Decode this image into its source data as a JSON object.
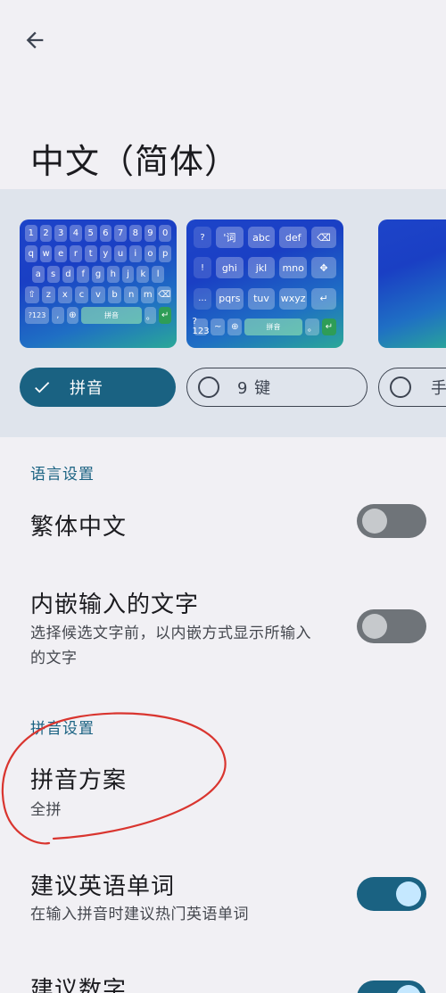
{
  "page": {
    "title": "中文（简体）"
  },
  "keyboard_previews": {
    "qwerty": {
      "row1": [
        "1",
        "2",
        "3",
        "4",
        "5",
        "6",
        "7",
        "8",
        "9",
        "0"
      ],
      "row2": [
        "q",
        "w",
        "e",
        "r",
        "t",
        "y",
        "u",
        "i",
        "o",
        "p"
      ],
      "row3": [
        "a",
        "s",
        "d",
        "f",
        "g",
        "h",
        "j",
        "k",
        "l"
      ],
      "row4": [
        "z",
        "x",
        "c",
        "v",
        "b",
        "n",
        "m"
      ],
      "row5": [
        "?123",
        ",",
        "拼音",
        "。"
      ]
    },
    "nine_key": {
      "keys": [
        "'词",
        "abc",
        "def",
        "ghi",
        "jkl",
        "mno",
        "pqrs",
        "tuv",
        "wxyz"
      ],
      "side": [
        "?",
        "!",
        "...",
        "~"
      ],
      "bottom": [
        "?123",
        ",",
        "拼音",
        "。"
      ]
    }
  },
  "layouts": [
    {
      "label": "拼音",
      "selected": true
    },
    {
      "label": "9 键",
      "selected": false
    },
    {
      "label": "手",
      "selected": false
    }
  ],
  "sections": {
    "language": {
      "header": "语言设置",
      "traditional": {
        "title": "繁体中文",
        "enabled": false
      },
      "inline": {
        "title": "内嵌输入的文字",
        "summary_line1": "选择候选文字前，以内嵌方式显示所输入",
        "summary_line2": "的文字",
        "enabled": false
      }
    },
    "pinyin": {
      "header": "拼音设置",
      "scheme": {
        "title": "拼音方案",
        "summary": "全拼"
      },
      "suggest_english": {
        "title": "建议英语单词",
        "summary": "在输入拼音时建议热门英语单词",
        "enabled": true
      },
      "suggest_numbers": {
        "title": "建议数字",
        "enabled": true
      }
    }
  },
  "colors": {
    "accent": "#1a6282",
    "background": "#f1f0f4",
    "annotation": "#d9352f"
  }
}
